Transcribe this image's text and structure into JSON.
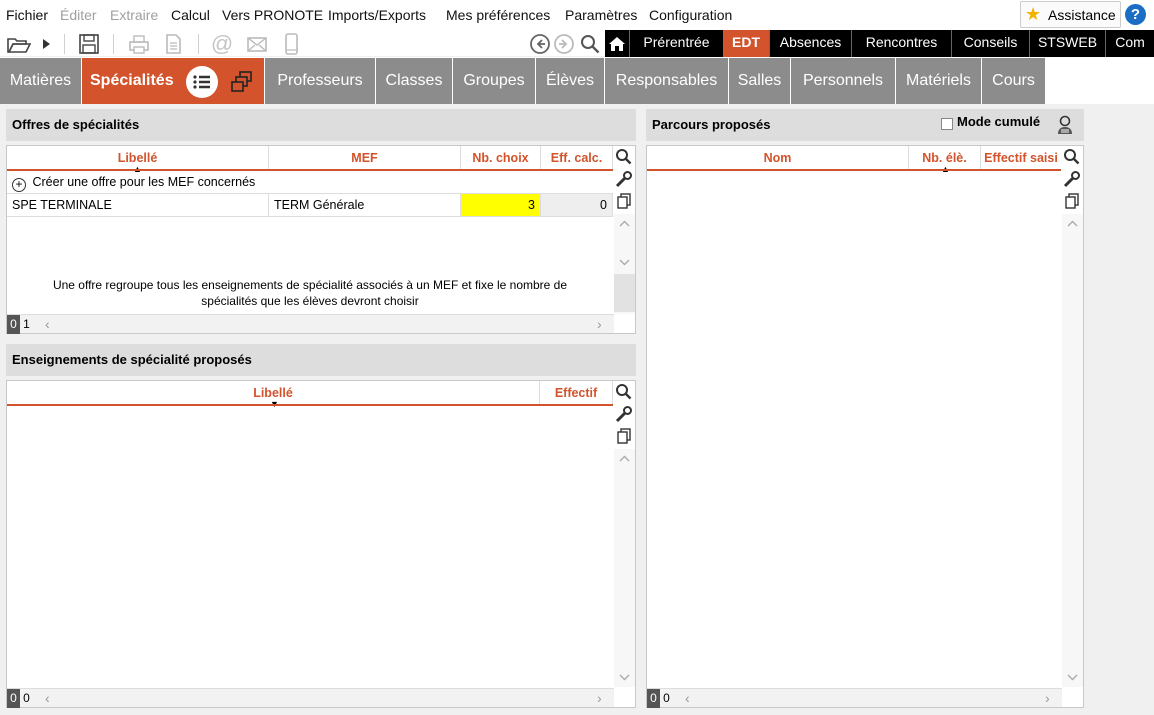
{
  "menu": {
    "items": [
      {
        "label": "Fichier",
        "enabled": true
      },
      {
        "label": "Éditer",
        "enabled": false
      },
      {
        "label": "Extraire",
        "enabled": false
      },
      {
        "label": "Calcul",
        "enabled": true
      },
      {
        "label": "Vers PRONOTE",
        "enabled": true
      },
      {
        "label": "Imports/Exports",
        "enabled": true
      },
      {
        "label": "Mes préférences",
        "enabled": true
      },
      {
        "label": "Paramètres",
        "enabled": true
      },
      {
        "label": "Configuration",
        "enabled": true
      }
    ],
    "assistance_label": "Assistance",
    "help_label": "?"
  },
  "top_tabs": [
    {
      "label": "Prérentrée",
      "active": false
    },
    {
      "label": "EDT",
      "active": true
    },
    {
      "label": "Absences",
      "active": false
    },
    {
      "label": "Rencontres",
      "active": false
    },
    {
      "label": "Conseils",
      "active": false
    },
    {
      "label": "STSWEB",
      "active": false
    },
    {
      "label": "Com",
      "active": false
    }
  ],
  "nav_tabs": [
    {
      "label": "Matières",
      "active": false
    },
    {
      "label": "Spécialités",
      "active": true
    },
    {
      "label": "Professeurs",
      "active": false
    },
    {
      "label": "Classes",
      "active": false
    },
    {
      "label": "Groupes",
      "active": false
    },
    {
      "label": "Élèves",
      "active": false
    },
    {
      "label": "Responsables",
      "active": false
    },
    {
      "label": "Salles",
      "active": false
    },
    {
      "label": "Personnels",
      "active": false
    },
    {
      "label": "Matériels",
      "active": false
    },
    {
      "label": "Cours",
      "active": false
    }
  ],
  "offres": {
    "title": "Offres de spécialités",
    "columns": [
      "Libellé",
      "MEF",
      "Nb. choix",
      "Eff. calc."
    ],
    "create_label": "Créer une offre pour les MEF concernés",
    "rows": [
      {
        "libelle": "SPE TERMINALE",
        "mef": "TERM Générale",
        "nb_choix": "3",
        "eff_calc": "0"
      }
    ],
    "info": "Une offre regroupe tous les enseignements de spécialité associés à un MEF et fixe le nombre de spécialités que les élèves devront choisir",
    "count_selected": "0",
    "count_total": "1",
    "highlight_color": "#ffff00"
  },
  "enseignements": {
    "title": "Enseignements de spécialité proposés",
    "columns": [
      "Libellé",
      "Effectif"
    ],
    "count_selected": "0",
    "count_total": "0"
  },
  "parcours": {
    "title": "Parcours proposés",
    "mode_cumule_label": "Mode cumulé",
    "columns": [
      "Nom",
      "Nb. élè.",
      "Effectif saisi"
    ],
    "count_selected": "0",
    "count_total": "0"
  },
  "colors": {
    "accent": "#d2532c",
    "tab_gray": "#8c8c8c",
    "topbar": "#000000"
  }
}
